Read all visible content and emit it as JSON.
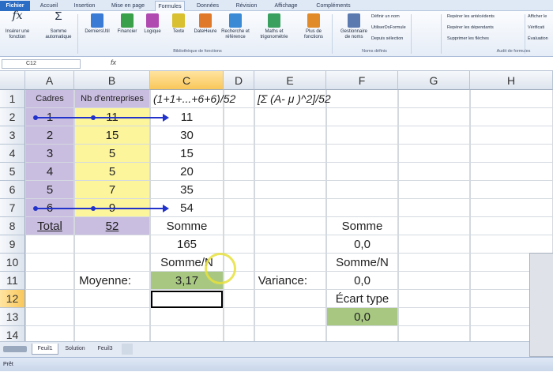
{
  "ribbon_tabs": [
    "Fichier",
    "Accueil",
    "Insertion",
    "Mise en page",
    "Formules",
    "Données",
    "Révision",
    "Affichage",
    "Compléments"
  ],
  "ribbon_buttons": [
    {
      "label": "Insérer une\nfonction",
      "icon": "fx-icon",
      "color": "#555"
    },
    {
      "label": "Somme\nautomatique",
      "icon": "sigma-icon",
      "color": "#555"
    },
    {
      "label": "DerniersUtil",
      "icon": "book-icon",
      "color": "#3a7bd5"
    },
    {
      "label": "Financier",
      "icon": "book-icon",
      "color": "#3aa04a"
    },
    {
      "label": "Logique",
      "icon": "book-icon",
      "color": "#b04ab0"
    },
    {
      "label": "Texte",
      "icon": "book-icon",
      "color": "#d8c030"
    },
    {
      "label": "DateHeure",
      "icon": "book-icon",
      "color": "#e07a2a"
    },
    {
      "label": "Recherche et\nréférence",
      "icon": "book-icon",
      "color": "#3a8ad5"
    },
    {
      "label": "Maths et\ntrigonométrie",
      "icon": "book-icon",
      "color": "#3aa060"
    },
    {
      "label": "Plus de\nfonctions",
      "icon": "book-icon",
      "color": "#e08a2a"
    },
    {
      "label": "Gestionnaire\nde noms",
      "icon": "name-manager-icon",
      "color": "#5a7ab0"
    }
  ],
  "ribbon_small": {
    "define_name": "Définir un nom",
    "use_in_formula": "UtiliserDsFormule",
    "from_selection": "Depuis sélection",
    "trace_precedents": "Repérer les antécédents",
    "trace_dependents": "Repérer les dépendants",
    "remove_arrows": "Supprimer les flèches",
    "show_formulas": "Afficher le",
    "error_check": "Vérificati",
    "evaluate": "Évaluation"
  },
  "ribbon_groups": [
    "Bibliothèque de fonctions",
    "Noms définis",
    "Audit de formules"
  ],
  "name_box": "C12",
  "fx_label": "fx",
  "formula": "",
  "columns": [
    "A",
    "B",
    "C",
    "D",
    "E",
    "F",
    "G",
    "H"
  ],
  "rows": [
    "1",
    "2",
    "3",
    "4",
    "5",
    "6",
    "7",
    "8",
    "9",
    "10",
    "11",
    "12",
    "13",
    "14"
  ],
  "selected_cell": {
    "column": "C",
    "row": "12"
  },
  "colors": {
    "purple": "#c9bde0",
    "yellow": "#fdf59c",
    "green": "#a8c882",
    "arrow": "#2233cc",
    "select_header": "#f9c75a"
  },
  "cells": [
    {
      "ref": "A1",
      "value": "Cadres"
    },
    {
      "ref": "B1",
      "value": "Nb d'entreprises"
    },
    {
      "ref": "C1",
      "value": "(1+1+...+6+6)/52"
    },
    {
      "ref": "E1",
      "value": "[Σ (A- μ )^2]/52"
    },
    {
      "ref": "A2",
      "value": "1"
    },
    {
      "ref": "B2",
      "value": "11"
    },
    {
      "ref": "C2",
      "value": "11"
    },
    {
      "ref": "A3",
      "value": "2"
    },
    {
      "ref": "B3",
      "value": "15"
    },
    {
      "ref": "C3",
      "value": "30"
    },
    {
      "ref": "A4",
      "value": "3"
    },
    {
      "ref": "B4",
      "value": "5"
    },
    {
      "ref": "C4",
      "value": "15"
    },
    {
      "ref": "A5",
      "value": "4"
    },
    {
      "ref": "B5",
      "value": "5"
    },
    {
      "ref": "C5",
      "value": "20"
    },
    {
      "ref": "A6",
      "value": "5"
    },
    {
      "ref": "B6",
      "value": "7"
    },
    {
      "ref": "C6",
      "value": "35"
    },
    {
      "ref": "A7",
      "value": "6"
    },
    {
      "ref": "B7",
      "value": "9"
    },
    {
      "ref": "C7",
      "value": "54"
    },
    {
      "ref": "A8",
      "value": "Total"
    },
    {
      "ref": "B8",
      "value": "52"
    },
    {
      "ref": "C8",
      "value": "Somme"
    },
    {
      "ref": "F8",
      "value": "Somme"
    },
    {
      "ref": "C9",
      "value": "165"
    },
    {
      "ref": "F9",
      "value": "0,0"
    },
    {
      "ref": "C10",
      "value": "Somme/N"
    },
    {
      "ref": "F10",
      "value": "Somme/N"
    },
    {
      "ref": "B11",
      "value": "Moyenne:"
    },
    {
      "ref": "C11",
      "value": "3,17"
    },
    {
      "ref": "E11",
      "value": "Variance:"
    },
    {
      "ref": "F11",
      "value": "0,0"
    },
    {
      "ref": "F12",
      "value": "Écart type"
    },
    {
      "ref": "F13",
      "value": "0,0"
    }
  ],
  "sheet_tabs": [
    "Feuil1",
    "Solution",
    "Feuil3"
  ],
  "status_text": "Prêt"
}
